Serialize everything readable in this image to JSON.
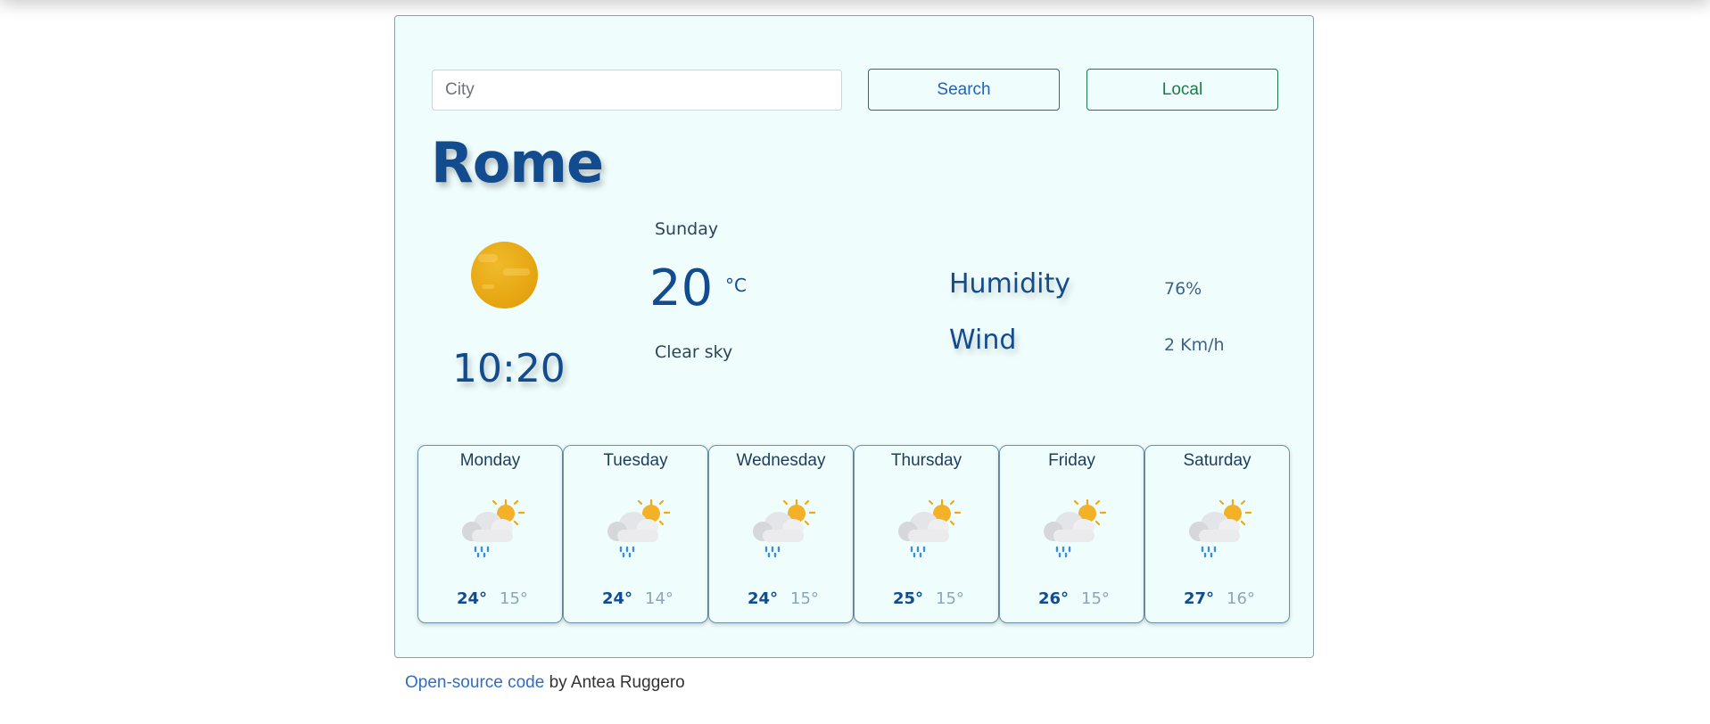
{
  "search": {
    "placeholder": "City",
    "search_label": "Search",
    "local_label": "Local"
  },
  "current": {
    "city": "Rome",
    "time": "10:20",
    "day": "Sunday",
    "temperature": "20",
    "unit": "°C",
    "description": "Clear sky",
    "icon": "sun-icon"
  },
  "stats": {
    "humidity_label": "Humidity",
    "humidity_value": "76%",
    "wind_label": "Wind",
    "wind_value": "2 Km/h"
  },
  "forecast": [
    {
      "day": "Monday",
      "max": "24°",
      "min": "15°",
      "icon": "sun-cloud-rain-icon"
    },
    {
      "day": "Tuesday",
      "max": "24°",
      "min": "14°",
      "icon": "sun-cloud-rain-icon"
    },
    {
      "day": "Wednesday",
      "max": "24°",
      "min": "15°",
      "icon": "sun-cloud-rain-icon"
    },
    {
      "day": "Thursday",
      "max": "25°",
      "min": "15°",
      "icon": "sun-cloud-rain-icon"
    },
    {
      "day": "Friday",
      "max": "26°",
      "min": "15°",
      "icon": "sun-cloud-rain-icon"
    },
    {
      "day": "Saturday",
      "max": "27°",
      "min": "16°",
      "icon": "sun-cloud-rain-icon"
    }
  ],
  "footer": {
    "link_text": "Open-source code",
    "suffix": " by Antea Ruggero"
  },
  "colors": {
    "primary": "#124c8e",
    "card_bg": "#f0fdfd",
    "search_button": "#2561b5",
    "local_button": "#1b7a4b",
    "sun": "#e7a713"
  }
}
